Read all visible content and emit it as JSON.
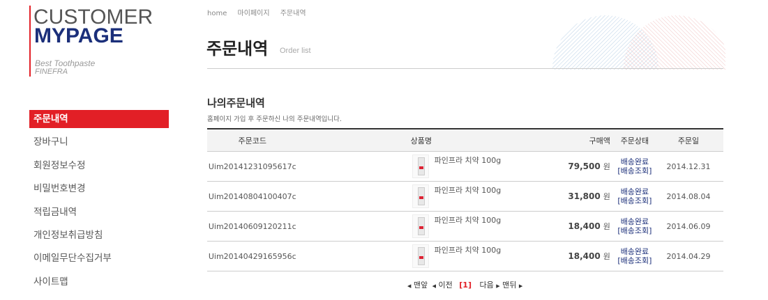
{
  "logo": {
    "line1": "CUSTOMER",
    "line2": "MYPAGE",
    "sub1": "Best Toothpaste",
    "sub2": "FINEFRA"
  },
  "sidebar": {
    "items": [
      {
        "label": "주문내역",
        "active": true
      },
      {
        "label": "장바구니"
      },
      {
        "label": "회원정보수정"
      },
      {
        "label": "비밀번호변경"
      },
      {
        "label": "적립금내역"
      },
      {
        "label": "개인정보취급방침"
      },
      {
        "label": "이메일무단수집거부"
      },
      {
        "label": "사이트맵"
      }
    ]
  },
  "breadcrumb": [
    "home",
    "마이페이지",
    "주문내역"
  ],
  "page": {
    "title": "주문내역",
    "subtitle": "Order list"
  },
  "section": {
    "title": "나의주문내역",
    "desc": "홈페이지 가입 후 주문하신 나의 주문내역입니다."
  },
  "table": {
    "headers": [
      "주문코드",
      "상품명",
      "구매액",
      "주문상태",
      "주문일"
    ],
    "rows": [
      {
        "code": "Uim20141231095617c",
        "product": "파인프라 치약 100g",
        "amount": "79,500",
        "unit": "원",
        "status": "배송완료",
        "track": "[배송조회]",
        "date": "2014.12.31"
      },
      {
        "code": "Uim20140804100407c",
        "product": "파인프라 치약 100g",
        "amount": "31,800",
        "unit": "원",
        "status": "배송완료",
        "track": "[배송조회]",
        "date": "2014.08.04"
      },
      {
        "code": "Uim20140609120211c",
        "product": "파인프라 치약 100g",
        "amount": "18,400",
        "unit": "원",
        "status": "배송완료",
        "track": "[배송조회]",
        "date": "2014.06.09"
      },
      {
        "code": "Uim20140429165956c",
        "product": "파인프라 치약 100g",
        "amount": "18,400",
        "unit": "원",
        "status": "배송완료",
        "track": "[배송조회]",
        "date": "2014.04.29"
      }
    ]
  },
  "pager": {
    "first": "맨앞",
    "prev": "이전",
    "current": "[1]",
    "next": "다음",
    "last": "맨뒤"
  },
  "colors": {
    "accent": "#e21f26",
    "brand": "#1b2f7a"
  }
}
